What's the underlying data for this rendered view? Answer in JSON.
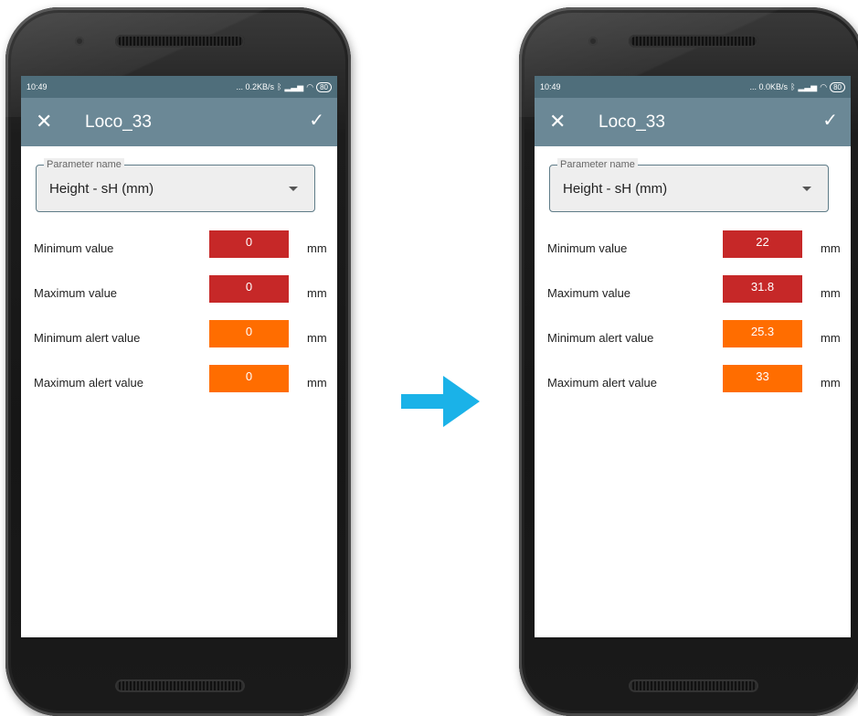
{
  "colors": {
    "app_bar": "#6b8896",
    "status_bar": "#4f6e7b",
    "limit_box": "#c62828",
    "alert_box": "#ff6d00",
    "arrow": "#1ab2e8"
  },
  "phones": [
    {
      "status": {
        "time": "10:49",
        "net": "... 0.2KB/s",
        "battery": "80"
      },
      "app": {
        "title": "Loco_33",
        "close_icon": "close-icon",
        "confirm_icon": "check-icon"
      },
      "parameter": {
        "label": "Parameter name",
        "value": "Height - sH (mm)"
      },
      "rows": [
        {
          "label": "Minimum value",
          "value": "0",
          "unit": "mm",
          "kind": "limit"
        },
        {
          "label": "Maximum value",
          "value": "0",
          "unit": "mm",
          "kind": "limit"
        },
        {
          "label": "Minimum alert value",
          "value": "0",
          "unit": "mm",
          "kind": "alert"
        },
        {
          "label": "Maximum alert value",
          "value": "0",
          "unit": "mm",
          "kind": "alert"
        }
      ]
    },
    {
      "status": {
        "time": "10:49",
        "net": "... 0.0KB/s",
        "battery": "80"
      },
      "app": {
        "title": "Loco_33",
        "close_icon": "close-icon",
        "confirm_icon": "check-icon"
      },
      "parameter": {
        "label": "Parameter name",
        "value": "Height - sH (mm)"
      },
      "rows": [
        {
          "label": "Minimum value",
          "value": "22",
          "unit": "mm",
          "kind": "limit"
        },
        {
          "label": "Maximum value",
          "value": "31.8",
          "unit": "mm",
          "kind": "limit"
        },
        {
          "label": "Minimum alert value",
          "value": "25.3",
          "unit": "mm",
          "kind": "alert"
        },
        {
          "label": "Maximum alert value",
          "value": "33",
          "unit": "mm",
          "kind": "alert"
        }
      ]
    }
  ],
  "transition_icon": "arrow-right-icon"
}
